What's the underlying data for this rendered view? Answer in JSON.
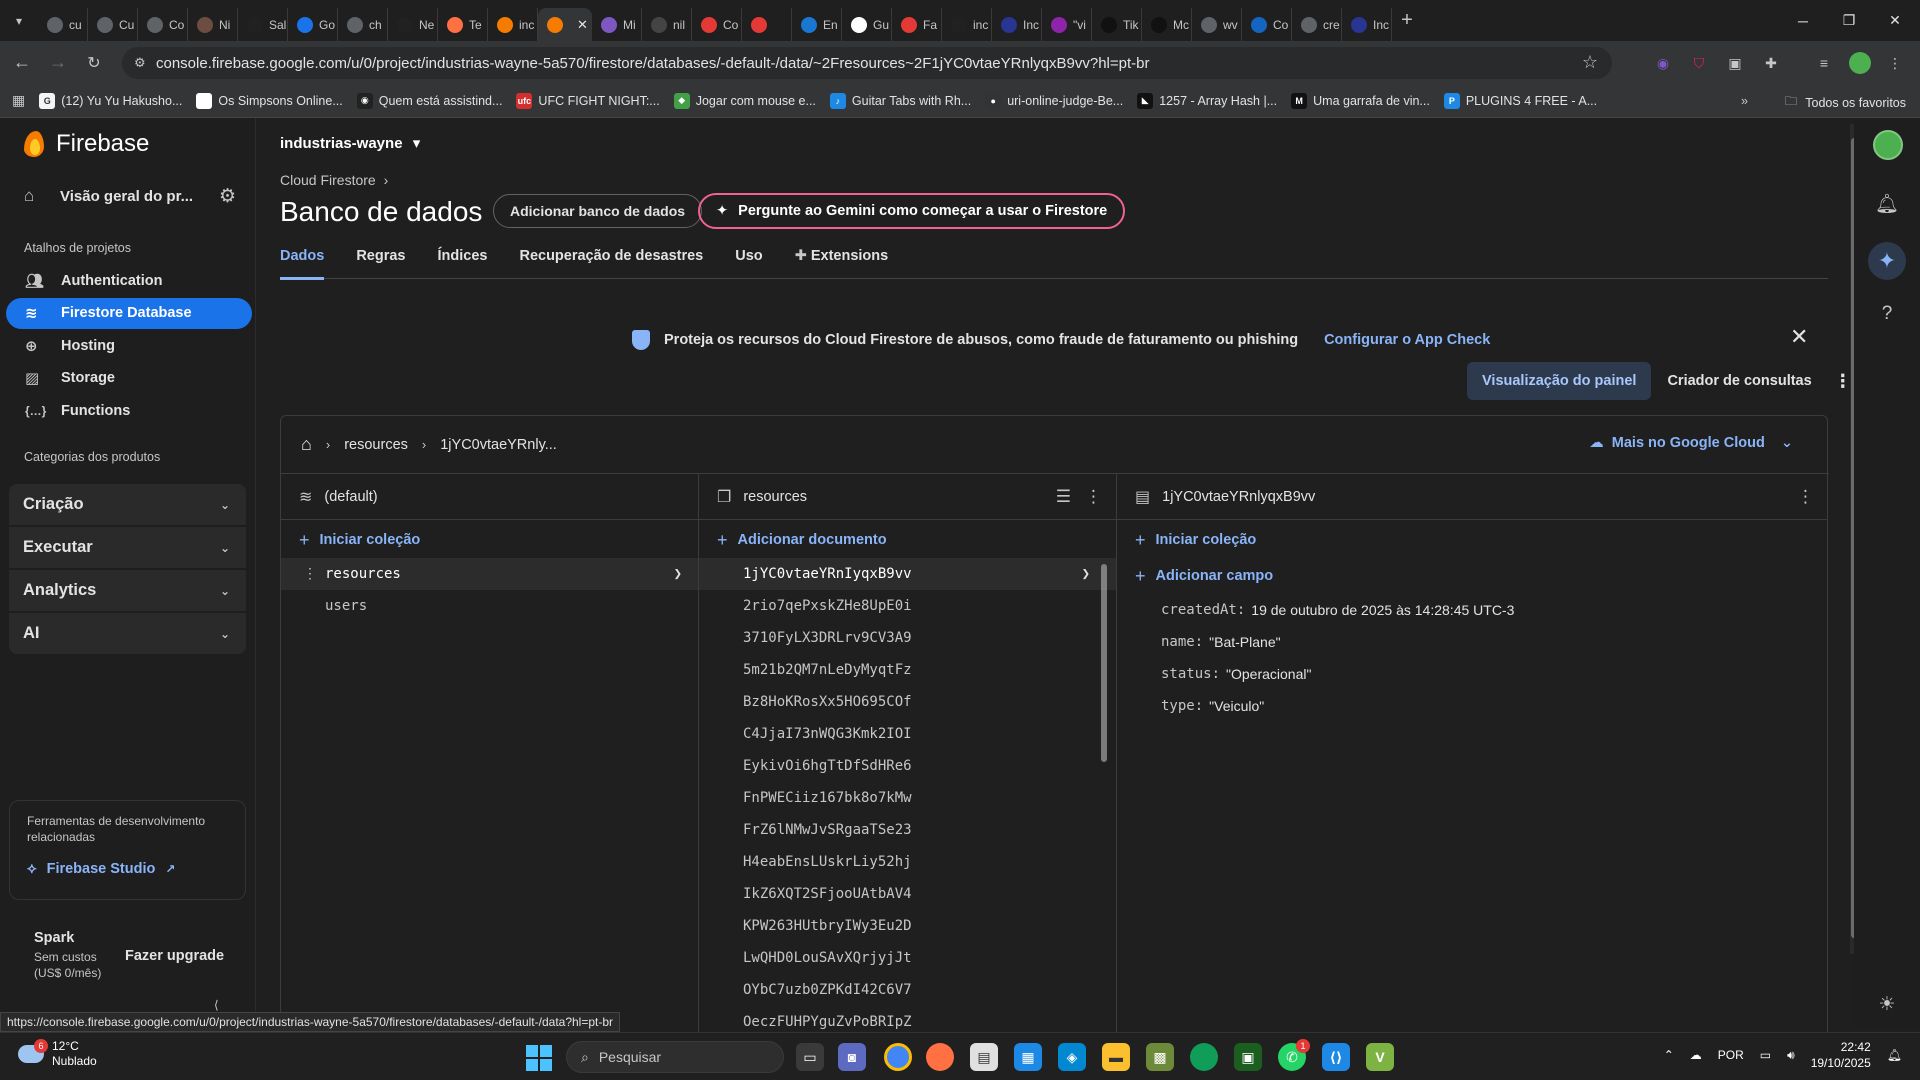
{
  "browser": {
    "tabs": [
      {
        "label": "cu",
        "icon": "globe-icon",
        "color": "#5f6368"
      },
      {
        "label": "Cu",
        "icon": "cloud-icon",
        "color": "#5f6368"
      },
      {
        "label": "Co",
        "icon": "globe-icon",
        "color": "#5f6368"
      },
      {
        "label": "Ni",
        "icon": "person-icon",
        "color": "#6d4c41"
      },
      {
        "label": "Sal",
        "icon": "a-icon",
        "color": "#212121"
      },
      {
        "label": "Go",
        "icon": "gemini-icon",
        "color": "#1a73e8"
      },
      {
        "label": "ch",
        "icon": "globe-icon",
        "color": "#5f6368"
      },
      {
        "label": "Ne",
        "icon": "a-icon",
        "color": "#212121"
      },
      {
        "label": "Te",
        "icon": "tab-icon",
        "color": "#ff7043"
      },
      {
        "label": "inc",
        "icon": "firebase-icon",
        "color": "#f57c00"
      },
      {
        "label": "",
        "icon": "firebase-icon",
        "color": "#f57c00",
        "active": true
      },
      {
        "label": "Mi",
        "icon": "copilot-icon",
        "color": "#7e57c2"
      },
      {
        "label": "nil",
        "icon": "github-icon",
        "color": "#444"
      },
      {
        "label": "Co",
        "icon": "youtube-icon",
        "color": "#e53935"
      },
      {
        "label": "",
        "icon": "youtube-icon",
        "color": "#e53935"
      },
      {
        "label": "En",
        "icon": "outlook-icon",
        "color": "#1976d2"
      },
      {
        "label": "Gu",
        "icon": "gmail-icon",
        "color": "#ffffff"
      },
      {
        "label": "Fa",
        "icon": "f-icon",
        "color": "#e53935"
      },
      {
        "label": "inc",
        "icon": "a-icon",
        "color": "#212121"
      },
      {
        "label": "Inc",
        "icon": "w-icon",
        "color": "#283593"
      },
      {
        "label": "\"vi",
        "icon": "ok-icon",
        "color": "#8e24aa"
      },
      {
        "label": "Tik",
        "icon": "tiktok-icon",
        "color": "#111"
      },
      {
        "label": "Mc",
        "icon": "tiktok-icon",
        "color": "#111"
      },
      {
        "label": "wv",
        "icon": "globe-icon",
        "color": "#5f6368"
      },
      {
        "label": "Co",
        "icon": "window-icon",
        "color": "#1565c0"
      },
      {
        "label": "cre",
        "icon": "globe-icon",
        "color": "#5f6368"
      },
      {
        "label": "Inc",
        "icon": "w-icon",
        "color": "#283593"
      }
    ],
    "url": "console.firebase.google.com/u/0/project/industrias-wayne-5a570/firestore/databases/-default-/data/~2Fresources~2F1jYC0vtaeYRnlyqxB9vv?hl=pt-br",
    "bookmarks": [
      {
        "label": "(12) Yu Yu Hakusho...",
        "color": "#f5f5f5",
        "glyph": "G"
      },
      {
        "label": "Os Simpsons Online...",
        "color": "#ffffff",
        "glyph": ""
      },
      {
        "label": "Quem está assistind...",
        "color": "#222",
        "glyph": "◉"
      },
      {
        "label": "UFC FIGHT NIGHT:...",
        "color": "#d32f2f",
        "glyph": "ufc"
      },
      {
        "label": "Jogar com mouse e...",
        "color": "#43a047",
        "glyph": "◆"
      },
      {
        "label": "Guitar Tabs with Rh...",
        "color": "#1e88e5",
        "glyph": "♪"
      },
      {
        "label": "uri-online-judge-Be...",
        "color": "#333",
        "glyph": "●"
      },
      {
        "label": "1257 - Array Hash |...",
        "color": "#111",
        "glyph": "◣"
      },
      {
        "label": "Uma garrafa de vin...",
        "color": "#111",
        "glyph": "M"
      },
      {
        "label": "PLUGINS 4 FREE - A...",
        "color": "#1e88e5",
        "glyph": "P"
      }
    ],
    "all_bookmarks": "Todos os favoritos",
    "status_url": "https://console.firebase.google.com/u/0/project/industrias-wayne-5a570/firestore/databases/-default-/data?hl=pt-br"
  },
  "sidebar": {
    "brand": "Firebase",
    "overview": "Visão geral do pr...",
    "shortcuts_heading": "Atalhos de projetos",
    "items": [
      {
        "label": "Authentication",
        "icon": "people-icon"
      },
      {
        "label": "Firestore Database",
        "icon": "firestore-icon",
        "active": true
      },
      {
        "label": "Hosting",
        "icon": "hosting-icon"
      },
      {
        "label": "Storage",
        "icon": "storage-icon"
      },
      {
        "label": "Functions",
        "icon": "functions-icon"
      }
    ],
    "categories_heading": "Categorias dos produtos",
    "categories": [
      "Criação",
      "Executar",
      "Analytics",
      "AI"
    ],
    "tools_text": "Ferramentas de desenvolvimento relacionadas",
    "studio": "Firebase Studio",
    "plan": {
      "name": "Spark",
      "cost": "Sem custos",
      "price": "(US$ 0/mês)"
    },
    "upgrade": "Fazer upgrade"
  },
  "main": {
    "project": "industrias-wayne",
    "breadcrumb": "Cloud Firestore",
    "title": "Banco de dados",
    "add_db": "Adicionar banco de dados",
    "gemini": "Pergunte ao Gemini como começar a usar o Firestore",
    "tabs": [
      "Dados",
      "Regras",
      "Índices",
      "Recuperação de desastres",
      "Uso",
      "Extensions"
    ],
    "banner": {
      "text": "Proteja os recursos do Cloud Firestore de abusos, como fraude de faturamento ou phishing",
      "link": "Configurar o App Check"
    },
    "view_panel": "Visualização do painel",
    "query_builder": "Criador de consultas",
    "path": [
      "resources",
      "1jYC0vtaeYRnly..."
    ],
    "gcloud": "Mais no Google Cloud"
  },
  "columns": {
    "db": {
      "title": "(default)",
      "add": "Iniciar coleção",
      "collections": [
        "resources",
        "users"
      ]
    },
    "collection": {
      "title": "resources",
      "add": "Adicionar documento",
      "docs": [
        "1jYC0vtaeYRnIyqxB9vv",
        "2rio7qePxskZHe8UpE0i",
        "3710FyLX3DRLrv9CV3A9",
        "5m21b2QM7nLeDyMyqtFz",
        "Bz8HoKRosXx5HO695COf",
        "C4JjaI73nWQG3Kmk2IOI",
        "EykivOi6hgTtDfSdHRe6",
        "FnPWECiiz167bk8o7kMw",
        "FrZ6lNMwJvSRgaaTSe23",
        "H4eabEnsLUskrLiy52hj",
        "IkZ6XQT2SFjooUAtbAV4",
        "KPW263HUtbryIWy3Eu2D",
        "LwQHD0LouSAvXQrjyjJt",
        "OYbC7uzb0ZPKdI42C6V7",
        "OeczFUHPYguZvPoBRIpZ"
      ]
    },
    "document": {
      "title": "1jYC0vtaeYRnlyqxB9vv",
      "add_collection": "Iniciar coleção",
      "add_field": "Adicionar campo",
      "fields": [
        {
          "key": "createdAt:",
          "value": "19 de outubro de 2025 às 14:28:45 UTC-3"
        },
        {
          "key": "name:",
          "value": "\"Bat-Plane\""
        },
        {
          "key": "status:",
          "value": "\"Operacional\""
        },
        {
          "key": "type:",
          "value": "\"Veiculo\""
        }
      ]
    }
  },
  "taskbar": {
    "temp": "12°C",
    "weather": "Nublado",
    "weather_badge": "6",
    "search": "Pesquisar",
    "lang": "POR",
    "time": "22:42",
    "date": "19/10/2025",
    "whatsapp_badge": "1"
  }
}
